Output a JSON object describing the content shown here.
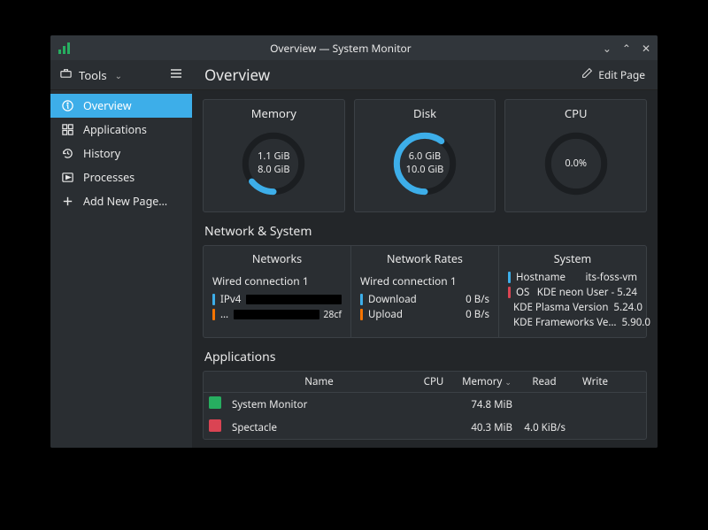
{
  "window": {
    "title": "Overview — System Monitor"
  },
  "toolbar": {
    "tools_label": "Tools",
    "page_title": "Overview",
    "edit_label": "Edit Page"
  },
  "sidebar": {
    "items": [
      {
        "label": "Overview",
        "icon": "info-icon",
        "active": true
      },
      {
        "label": "Applications",
        "icon": "grid-icon",
        "active": false
      },
      {
        "label": "History",
        "icon": "history-icon",
        "active": false
      },
      {
        "label": "Processes",
        "icon": "play-icon",
        "active": false
      },
      {
        "label": "Add New Page…",
        "icon": "plus-icon",
        "active": false
      }
    ]
  },
  "gauges": {
    "memory": {
      "title": "Memory",
      "line1": "1.1 GiB",
      "line2": "8.0 GiB",
      "percent": 14,
      "color": "#3daee9"
    },
    "disk": {
      "title": "Disk",
      "line1": "6.0 GiB",
      "line2": "10.0 GiB",
      "percent": 60,
      "color": "#3daee9"
    },
    "cpu": {
      "title": "CPU",
      "line1": "0.0%",
      "line2": "",
      "percent": 0,
      "color": "#3daee9"
    }
  },
  "network_system": {
    "section_title": "Network & System",
    "networks": {
      "title": "Networks",
      "connection": "Wired connection 1",
      "rows": [
        {
          "color": "#3daee9",
          "label": "IPv4",
          "value_redacted": true
        },
        {
          "color": "#f67400",
          "label": "…",
          "value_redacted": true,
          "suffix": "28cf"
        }
      ]
    },
    "rates": {
      "title": "Network Rates",
      "connection": "Wired connection 1",
      "rows": [
        {
          "color": "#3daee9",
          "label": "Download",
          "value": "0 B/s"
        },
        {
          "color": "#f67400",
          "label": "Upload",
          "value": "0 B/s"
        }
      ]
    },
    "system": {
      "title": "System",
      "rows": [
        {
          "color": "#3daee9",
          "label": "Hostname",
          "value": "its-foss-vm"
        },
        {
          "color": "#da4453",
          "label": "OS",
          "value": "KDE neon User - 5.24"
        },
        {
          "color": "#8e44ad",
          "label": "KDE Plasma Version",
          "value": "5.24.0"
        },
        {
          "color": "#f2cb05",
          "label": "KDE Frameworks Ve…",
          "value": "5.90.0"
        }
      ]
    }
  },
  "applications": {
    "section_title": "Applications",
    "columns": {
      "name": "Name",
      "cpu": "CPU",
      "memory": "Memory",
      "read": "Read",
      "write": "Write"
    },
    "sort": {
      "column": "memory",
      "dir": "desc"
    },
    "rows": [
      {
        "name": "System Monitor",
        "cpu": "",
        "memory": "74.8 MiB",
        "read": "",
        "write": "",
        "icon_color": "#27ae60"
      },
      {
        "name": "Spectacle",
        "cpu": "",
        "memory": "40.3 MiB",
        "read": "4.0 KiB/s",
        "write": "",
        "icon_color": "#da4453"
      }
    ]
  }
}
